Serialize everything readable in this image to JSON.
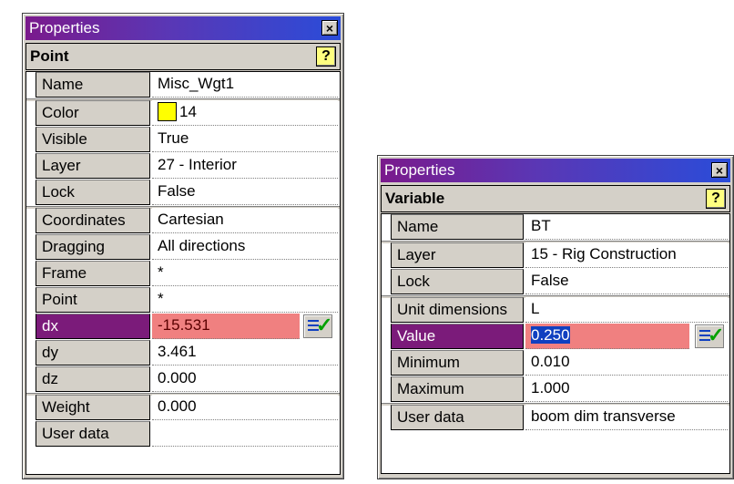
{
  "window1": {
    "title": "Properties",
    "close_label": "×",
    "header": "Point",
    "help_label": "?",
    "rows": [
      {
        "name": "Name",
        "value": "Misc_Wgt1"
      },
      {
        "name": "Color",
        "value": "14"
      },
      {
        "name": "Visible",
        "value": "True"
      },
      {
        "name": "Layer",
        "value": "27 - Interior"
      },
      {
        "name": "Lock",
        "value": "False"
      },
      {
        "name": "Coordinates",
        "value": "Cartesian"
      },
      {
        "name": "Dragging",
        "value": "All directions"
      },
      {
        "name": "Frame",
        "value": "*"
      },
      {
        "name": "Point",
        "value": "*"
      },
      {
        "name": "dx",
        "value": "-15.531"
      },
      {
        "name": "dy",
        "value": "3.461"
      },
      {
        "name": "dz",
        "value": "0.000"
      },
      {
        "name": "Weight",
        "value": "0.000"
      },
      {
        "name": "User data",
        "value": ""
      }
    ],
    "color_swatch": "#ffff00",
    "selected_row": "dx"
  },
  "window2": {
    "title": "Properties",
    "close_label": "×",
    "header": "Variable",
    "help_label": "?",
    "rows": [
      {
        "name": "Name",
        "value": "BT"
      },
      {
        "name": "Layer",
        "value": "15 - Rig Construction"
      },
      {
        "name": "Lock",
        "value": "False"
      },
      {
        "name": "Unit dimensions",
        "value": "L"
      },
      {
        "name": "Value",
        "value": "0.250"
      },
      {
        "name": "Minimum",
        "value": "0.010"
      },
      {
        "name": "Maximum",
        "value": "1.000"
      },
      {
        "name": "User data",
        "value": "boom dim transverse"
      }
    ],
    "selected_row": "Value"
  },
  "colors": {
    "title_gradient_start": "#7a1a8c",
    "title_gradient_end": "#2a4cd9",
    "selected_name_bg": "#7b1b7a",
    "selected_value_bg": "#f08080"
  }
}
